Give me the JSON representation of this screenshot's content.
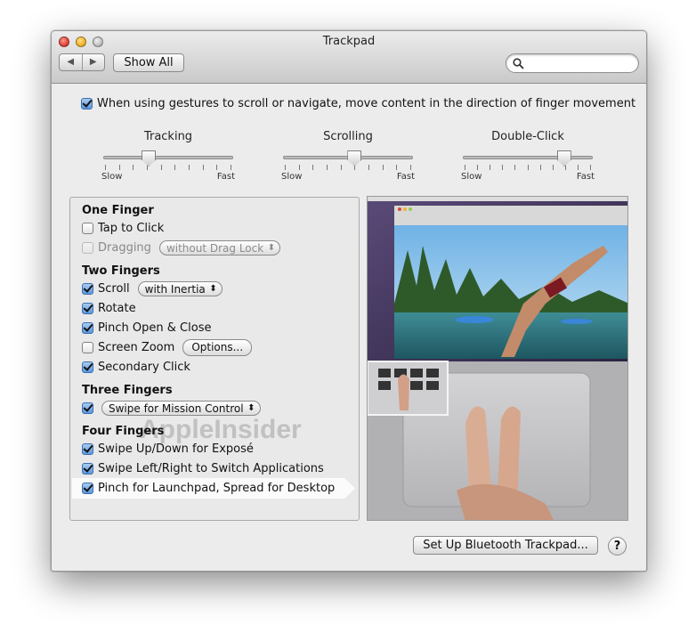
{
  "window": {
    "title": "Trackpad"
  },
  "toolbar": {
    "back_label": "◀",
    "forward_label": "▶",
    "show_all_label": "Show All",
    "search_placeholder": ""
  },
  "scroll_direction": {
    "label": "When using gestures to scroll or navigate, move content in the direction of finger movement",
    "checked": true
  },
  "sliders": [
    {
      "title": "Tracking",
      "min_label": "Slow",
      "max_label": "Fast",
      "ticks": 10,
      "value_fraction": 0.35
    },
    {
      "title": "Scrolling",
      "min_label": "Slow",
      "max_label": "Fast",
      "ticks": 10,
      "value_fraction": 0.55
    },
    {
      "title": "Double-Click",
      "min_label": "Slow",
      "max_label": "Fast",
      "ticks": 11,
      "value_fraction": 0.78
    }
  ],
  "gestures": {
    "one_finger": {
      "title": "One Finger",
      "tap_to_click": {
        "label": "Tap to Click",
        "checked": false
      },
      "dragging": {
        "label": "Dragging",
        "checked": false,
        "popup": "without Drag Lock"
      }
    },
    "two_fingers": {
      "title": "Two Fingers",
      "scroll": {
        "label": "Scroll",
        "checked": true,
        "popup": "with Inertia"
      },
      "rotate": {
        "label": "Rotate",
        "checked": true
      },
      "pinch": {
        "label": "Pinch Open & Close",
        "checked": true
      },
      "screen_zoom": {
        "label": "Screen Zoom",
        "checked": false,
        "button": "Options..."
      },
      "secondary_click": {
        "label": "Secondary Click",
        "checked": true
      }
    },
    "three_fingers": {
      "title": "Three Fingers",
      "swipe": {
        "checked": true,
        "popup": "Swipe for Mission Control"
      }
    },
    "four_fingers": {
      "title": "Four Fingers",
      "expose": {
        "label": "Swipe Up/Down for Exposé",
        "checked": true
      },
      "switch_apps": {
        "label": "Swipe Left/Right to Switch Applications",
        "checked": true
      },
      "launchpad": {
        "label": "Pinch for Launchpad, Spread for Desktop",
        "checked": true
      }
    }
  },
  "watermark": "AppleInsider",
  "footer": {
    "setup_label": "Set Up Bluetooth Trackpad...",
    "help_label": "?"
  },
  "colors": {
    "checkbox_on": "#5a97de",
    "window_bg": "#ececec"
  }
}
